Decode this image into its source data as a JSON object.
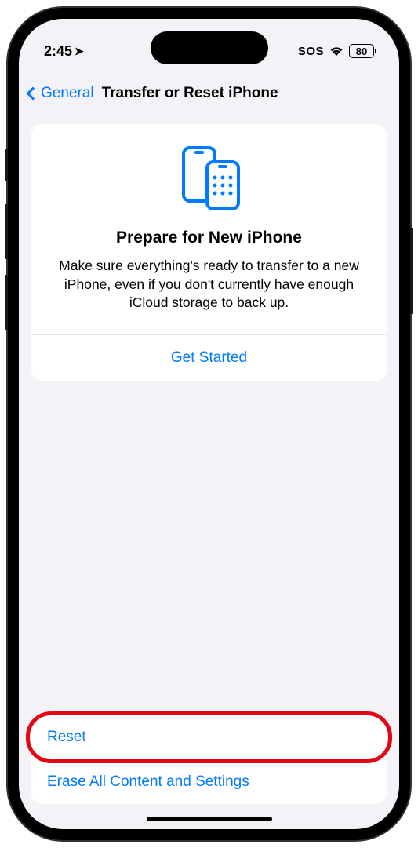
{
  "status": {
    "time": "2:45",
    "sos": "SOS",
    "battery": "80"
  },
  "nav": {
    "back_label": "General",
    "title": "Transfer or Reset iPhone"
  },
  "card": {
    "title": "Prepare for New iPhone",
    "description": "Make sure everything's ready to transfer to a new iPhone, even if you don't currently have enough iCloud storage to back up.",
    "action": "Get Started"
  },
  "actions": {
    "reset": "Reset",
    "erase": "Erase All Content and Settings"
  }
}
